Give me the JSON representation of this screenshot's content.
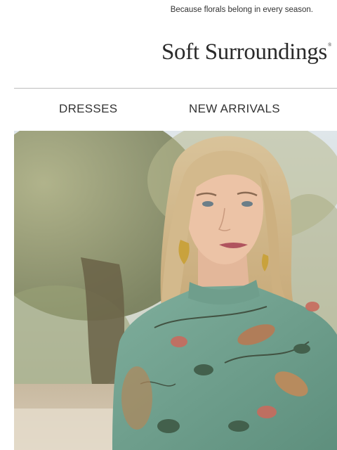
{
  "preheader": {
    "text": "Because florals belong in every season."
  },
  "brand": {
    "logo_text": "Soft Surroundings",
    "registered_mark": "®"
  },
  "nav": {
    "items": [
      {
        "label": "DRESSES"
      },
      {
        "label": "NEW ARRIVALS"
      }
    ]
  },
  "hero": {
    "icon": "hero-photo",
    "accent": "#6f9e8c"
  }
}
